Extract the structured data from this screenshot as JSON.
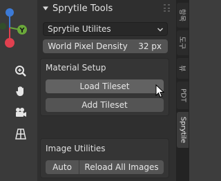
{
  "viewport": {
    "gizmo": {
      "axis_y_label": "Y",
      "colors": {
        "x": "#e0404f",
        "y": "#6aa83a",
        "z": "#3c7ad6"
      }
    },
    "tools": [
      {
        "icon": "zoom-icon"
      },
      {
        "icon": "hand-pan-icon"
      },
      {
        "icon": "camera-icon"
      },
      {
        "icon": "grid-perspective-icon"
      }
    ]
  },
  "panel": {
    "title": "Sprytile Tools",
    "utilities_dropdown": {
      "value": "Sprytile Utilites"
    },
    "world_pixel_density": {
      "label": "World Pixel Density",
      "value": "32 px"
    },
    "material_setup": {
      "label": "Material Setup",
      "load_tileset": "Load Tileset",
      "add_tileset": "Add Tileset"
    },
    "image_utilities": {
      "label": "Image Utilities",
      "auto": "Auto",
      "reload_all_images": "Reload All Images"
    }
  },
  "tabs": [
    {
      "label": "항목",
      "active": false
    },
    {
      "label": "도구",
      "active": false
    },
    {
      "label": "뷰",
      "active": false
    },
    {
      "label": "PDT",
      "active": false
    },
    {
      "label": "Sprytile",
      "active": true
    }
  ],
  "colors": {
    "panel_bg": "#2f2f2f",
    "button": "#545454",
    "active_tab": "#3c3c3c"
  }
}
